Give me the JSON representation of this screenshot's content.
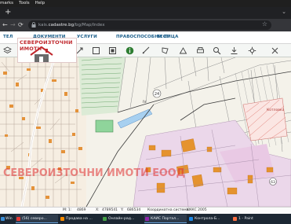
{
  "menu": [
    "marks",
    "Tools",
    "Help"
  ],
  "browser": {
    "new_tab_glyph": "+",
    "back_glyph": "←",
    "forward_glyph": "→",
    "reload_glyph": "⟳",
    "url_prefix": "kais.",
    "url_domain": "cadastre.bg",
    "url_path": "/bg/Map/Index",
    "star_glyph": "☆"
  },
  "app_nav": {
    "items": [
      "ТЕЛ",
      "ДОКУМЕНТИ",
      "УСЛУГИ",
      "ПРАВОСПОСОБНИ ЛИЦА",
      "ТЕСТ"
    ]
  },
  "toolbar": {
    "tools": [
      "layers-icon",
      "pan-icon",
      "zoom-in-icon",
      "zoom-out-icon",
      "zoom-box-icon",
      "full-extent-icon",
      "info-icon",
      "measure-icon",
      "polygon-icon",
      "area-icon",
      "print-icon",
      "identify-icon",
      "export-icon",
      "settings-icon",
      "clear-icon"
    ]
  },
  "map": {
    "labels": [
      {
        "name": "parcel-number-24",
        "text": "24"
      },
      {
        "name": "road-label-iv",
        "text": "IV"
      },
      {
        "name": "area-label-kotlovka",
        "text": "Котловка"
      },
      {
        "name": "road-label-63",
        "text": "63"
      }
    ],
    "watermark": "СЕВЕРОИЗТОЧНИ ИМОТИ ЕООД"
  },
  "logo": {
    "text": "СЕВЕРОИЗТОЧНИ ИМОТИ"
  },
  "status": {
    "scale_label": "М: 1:",
    "scale_value": "4869",
    "x_label": "X:",
    "x_value": "4789541",
    "y_label": "Y:",
    "y_value": "686534",
    "coord_label": "Координатна система:",
    "coord_value": "КККС 2005"
  },
  "taskbar": [
    {
      "label": "Win",
      "color": "#3b8ed8"
    },
    {
      "label": "(56) северо...",
      "color": "#e53935"
    },
    {
      "label": "Продава на ...",
      "color": "#fb8c00"
    },
    {
      "label": "Онлайн-рад...",
      "color": "#43a047"
    },
    {
      "label": "КАИС Портал...",
      "color": "#8e24aa"
    },
    {
      "label": "Контрола-Б...",
      "color": "#1e88e5"
    },
    {
      "label": "1 - Paint",
      "color": "#ff7043"
    }
  ],
  "colors": {
    "accent": "#1b5e8a",
    "brand_red": "#c0282d",
    "parcel_green": "#8fd49b",
    "building_orange": "#e5932e",
    "industrial_pink": "#ead3e6"
  }
}
